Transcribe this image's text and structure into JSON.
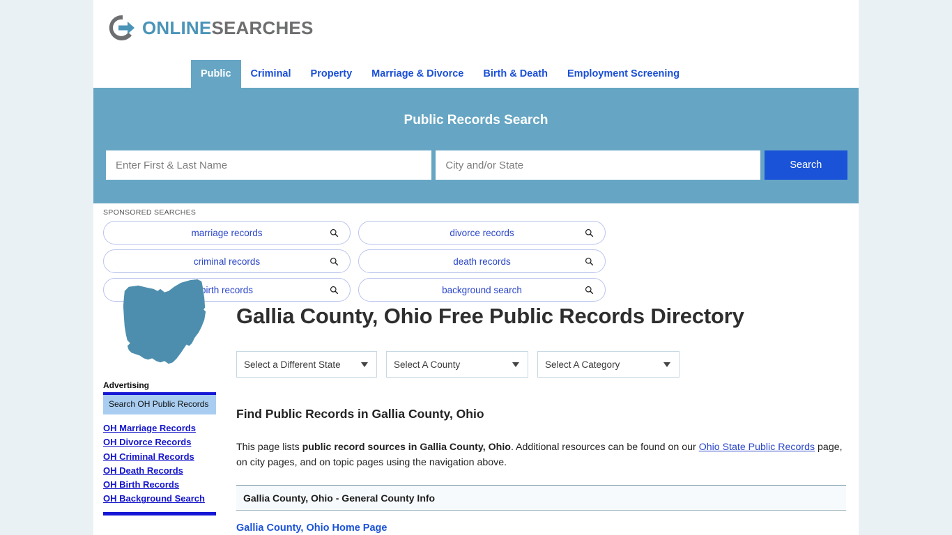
{
  "site": {
    "logo_primary": "ONLINE",
    "logo_secondary": "SEARCHES",
    "logo_icon": "circle-arrow-icon",
    "accent_teal": "#66a6c4",
    "accent_blue": "#1a52d8",
    "link_blue": "#2a46c8",
    "page_bg": "#eaf1f5"
  },
  "nav": {
    "items": [
      {
        "label": "Public",
        "active": true
      },
      {
        "label": "Criminal",
        "active": false
      },
      {
        "label": "Property",
        "active": false
      },
      {
        "label": "Marriage & Divorce",
        "active": false
      },
      {
        "label": "Birth & Death",
        "active": false
      },
      {
        "label": "Employment Screening",
        "active": false
      }
    ]
  },
  "banner": {
    "title": "Public Records Search",
    "name_placeholder": "Enter First & Last Name",
    "name_value": "",
    "city_placeholder": "City and/or State",
    "city_value": "",
    "search_button": "Search"
  },
  "sponsored": {
    "label": "SPONSORED SEARCHES",
    "items": [
      {
        "label": "marriage records",
        "icon": "search-icon"
      },
      {
        "label": "divorce records",
        "icon": "search-icon"
      },
      {
        "label": "criminal records",
        "icon": "search-icon"
      },
      {
        "label": "death records",
        "icon": "search-icon"
      },
      {
        "label": "birth records",
        "icon": "search-icon"
      },
      {
        "label": "background search",
        "icon": "search-icon"
      }
    ]
  },
  "sidebar": {
    "map_icon": "ohio-state-map-icon",
    "advertising_label": "Advertising",
    "ad_box_text": "Search OH Public Records",
    "links": [
      "OH Marriage Records",
      "OH Divorce Records",
      "OH Criminal Records",
      "OH Death Records",
      "OH Birth Records",
      "OH Background Search"
    ]
  },
  "main": {
    "title": "Gallia County, Ohio Free Public Records Directory",
    "selects": [
      {
        "label": "Select a Different State"
      },
      {
        "label": "Select A County"
      },
      {
        "label": "Select A Category"
      }
    ],
    "subheading": "Find Public Records in Gallia County, Ohio",
    "intro": {
      "part1": "This page lists ",
      "bold1": "public record sources in Gallia County, Ohio",
      "part2": ". Additional resources can be found on our ",
      "link": "Ohio State Public Records",
      "part3": " page, on city pages, and on topic pages using the navigation above."
    },
    "section_header": "Gallia County, Ohio - General County Info",
    "first_result": "Gallia County, Ohio Home Page"
  }
}
